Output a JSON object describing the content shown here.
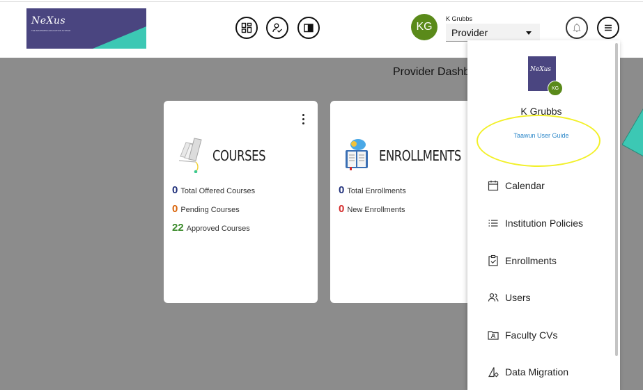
{
  "header": {
    "logo_text": "NeXus",
    "logo_subtitle": "THE MAXIMIZING EDUCATION SYSTEM",
    "user_initials": "KG",
    "user_name": "K Grubbs",
    "role_selected": "Provider",
    "icons": [
      "dashboard-grid-icon",
      "user-check-icon",
      "book-icon",
      "bell-icon",
      "menu-icon"
    ]
  },
  "main": {
    "title": "Provider Dashb",
    "cards": {
      "courses": {
        "title": "COURSES",
        "stats": [
          {
            "value": "0",
            "label": "Total Offered Courses",
            "color": "#1f2f7a"
          },
          {
            "value": "0",
            "label": "Pending Courses",
            "color": "#d9640a"
          },
          {
            "value": "22",
            "label": "Approved Courses",
            "color": "#3a8a2a"
          }
        ]
      },
      "enrollments": {
        "title": "ENROLLMENTS",
        "stats": [
          {
            "value": "0",
            "label": "Total Enrollments",
            "color": "#1f2f7a"
          },
          {
            "value": "0",
            "label": "New Enrollments",
            "color": "#d42a2a"
          }
        ]
      }
    }
  },
  "menu": {
    "logo_text": "NeXus",
    "avatar_initials": "KG",
    "username": "K Grubbs",
    "guide_link": "Taawun User Guide",
    "items": [
      {
        "label": "Calendar",
        "icon": "calendar-icon"
      },
      {
        "label": "Institution Policies",
        "icon": "list-icon"
      },
      {
        "label": "Enrollments",
        "icon": "clipboard-check-icon"
      },
      {
        "label": "Users",
        "icon": "users-icon"
      },
      {
        "label": "Faculty CVs",
        "icon": "folder-id-icon"
      },
      {
        "label": "Data Migration",
        "icon": "ruler-gear-icon"
      }
    ]
  },
  "colors": {
    "brand_purple": "#4a4580",
    "brand_teal": "#3cc8b4",
    "avatar_green": "#5a8a1a",
    "overlay_gray": "#8c8c8c",
    "highlight_yellow": "#f2f028",
    "link_blue": "#2a86c8"
  }
}
